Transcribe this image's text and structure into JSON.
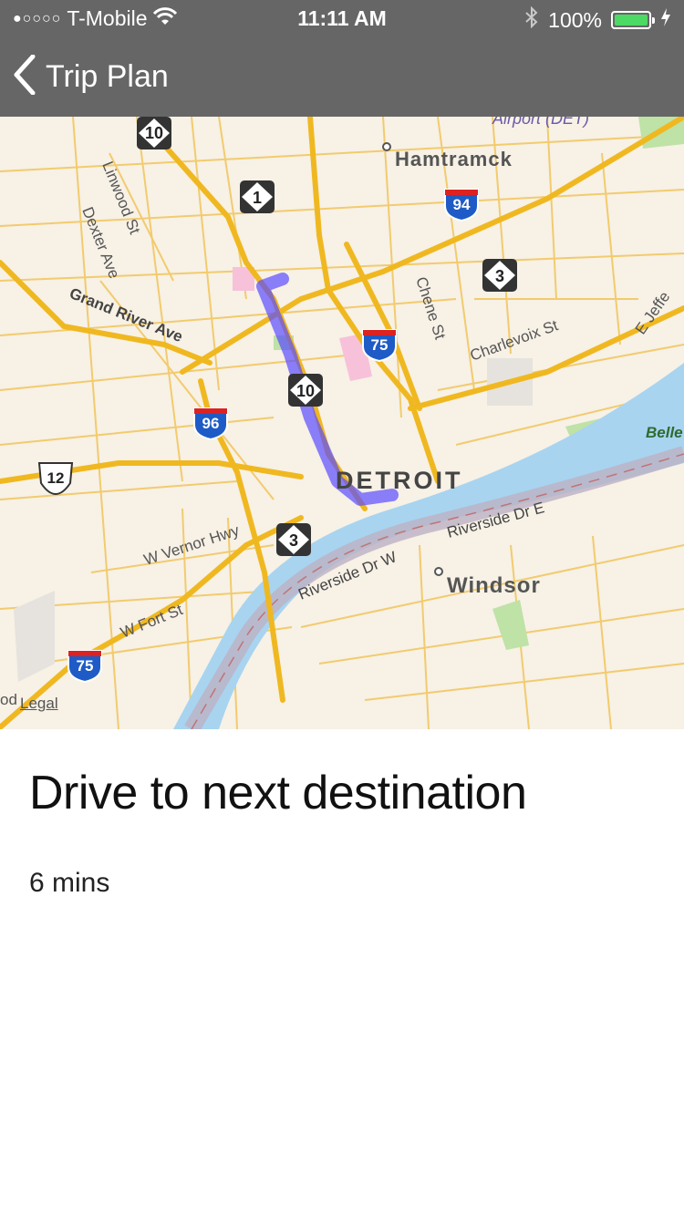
{
  "status_bar": {
    "carrier": "T-Mobile",
    "signal_dots": "●○○○○",
    "time": "11:11 AM",
    "battery": "100%",
    "battery_level": 1.0,
    "battery_color": "#4cd964"
  },
  "nav": {
    "back_label": "Trip Plan"
  },
  "map": {
    "legal": "Legal",
    "route_color": "#5a4bff",
    "labels": {
      "airport": "Airport (DET)",
      "hamtramck": "Hamtramck",
      "linwood": "Linwood St",
      "dexter": "Dexter Ave",
      "grand_river": "Grand River Ave",
      "chene": "Chene St",
      "charlevoix": "Charlevoix St",
      "jefferson": "E Jeffe",
      "belle": "Belle",
      "detroit": "DETROIT",
      "vernor": "W Vernor Hwy",
      "riverside_w": "Riverside Dr W",
      "riverside_e": "Riverside Dr E",
      "windsor": "Windsor",
      "fort": "W Fort St",
      "od": "od"
    },
    "shields": {
      "m10_top": "10",
      "m1": "1",
      "i94": "94",
      "m3_east": "3",
      "i75_north": "75",
      "m10_mid": "10",
      "i96": "96",
      "us12": "12",
      "m3_south": "3",
      "i75_south": "75"
    }
  },
  "trip": {
    "title": "Drive to next destination",
    "duration": "6 mins"
  }
}
